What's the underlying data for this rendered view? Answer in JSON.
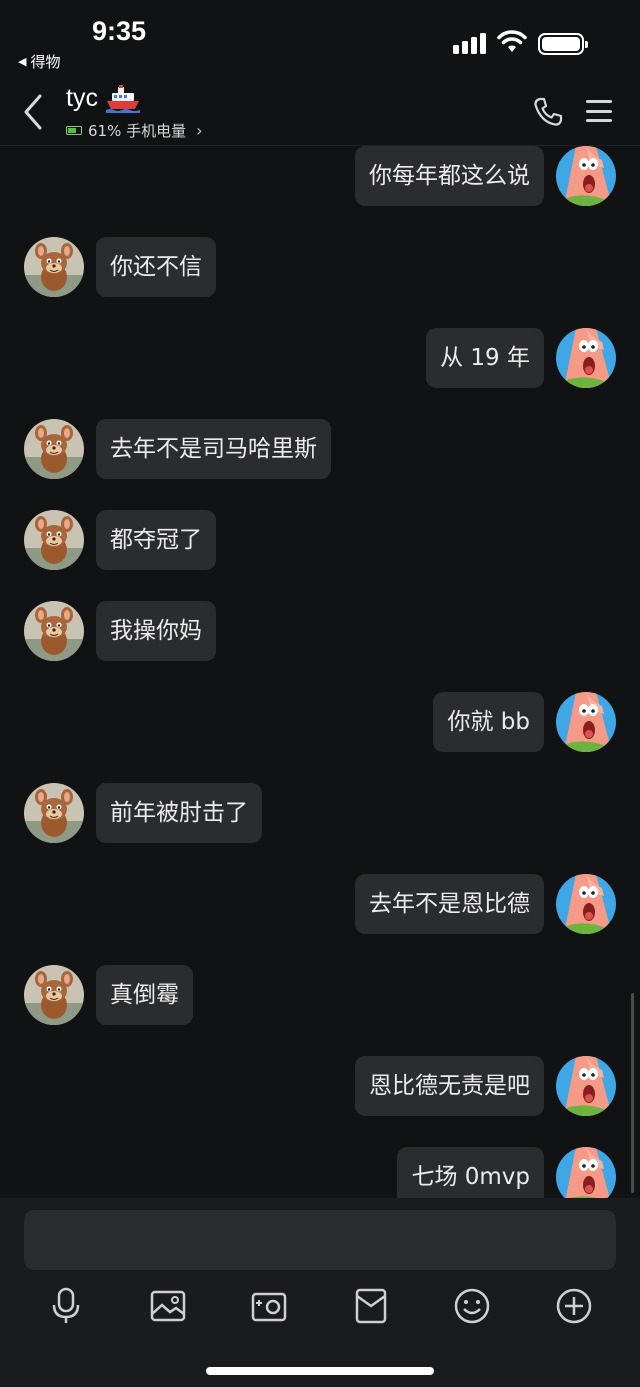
{
  "status_bar": {
    "time": "9:35",
    "back_app": "得物"
  },
  "header": {
    "contact_name": "tyc",
    "contact_emoji": "ship-icon",
    "status_text": "61% 手机电量",
    "battery_percent": 61
  },
  "messages": [
    {
      "side": "out",
      "text": "你每年都这么说"
    },
    {
      "side": "in",
      "text": "你还不信"
    },
    {
      "side": "out",
      "text": "从 19 年"
    },
    {
      "side": "in",
      "text": "去年不是司马哈里斯"
    },
    {
      "side": "in",
      "text": "都夺冠了"
    },
    {
      "side": "in",
      "text": "我操你妈"
    },
    {
      "side": "out",
      "text": "你就 bb"
    },
    {
      "side": "in",
      "text": "前年被肘击了"
    },
    {
      "side": "out",
      "text": "去年不是恩比德"
    },
    {
      "side": "in",
      "text": "真倒霉"
    },
    {
      "side": "out",
      "text": "恩比德无责是吧"
    },
    {
      "side": "out",
      "text": "七场 0mvp"
    }
  ],
  "input": {
    "value": "",
    "placeholder": ""
  },
  "toolbar": [
    "microphone-icon",
    "image-icon",
    "camera-icon",
    "red-packet-icon",
    "emoji-icon",
    "plus-icon"
  ]
}
